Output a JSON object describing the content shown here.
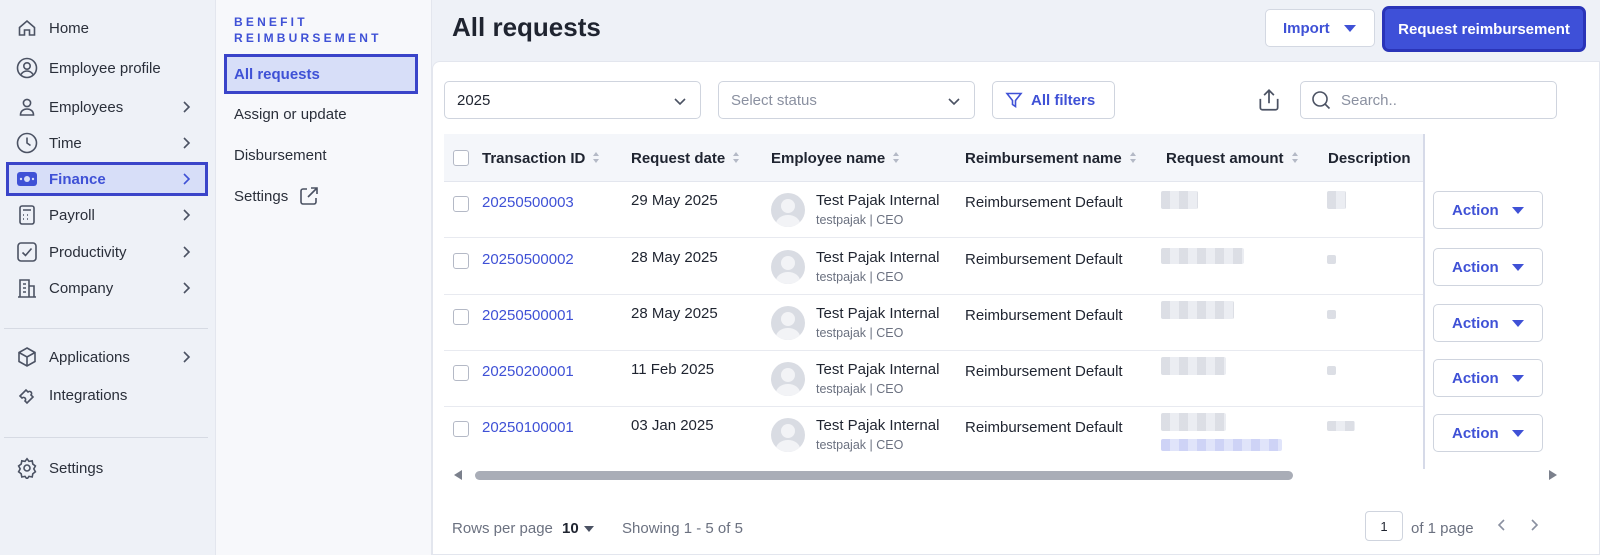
{
  "nav": {
    "items": [
      {
        "label": "Home",
        "icon": "home-icon",
        "chevron": false
      },
      {
        "label": "Employee profile",
        "icon": "user-circle-icon",
        "chevron": false
      },
      {
        "label": "Employees",
        "icon": "user-icon",
        "chevron": true
      },
      {
        "label": "Time",
        "icon": "clock-icon",
        "chevron": true
      },
      {
        "label": "Finance",
        "icon": "finance-icon",
        "chevron": true,
        "active": true
      },
      {
        "label": "Payroll",
        "icon": "calculator-icon",
        "chevron": true
      },
      {
        "label": "Productivity",
        "icon": "checkbox-icon",
        "chevron": true
      },
      {
        "label": "Company",
        "icon": "building-icon",
        "chevron": true
      },
      {
        "label": "Applications",
        "icon": "cube-icon",
        "chevron": true
      },
      {
        "label": "Integrations",
        "icon": "puzzle-icon",
        "chevron": false
      },
      {
        "label": "Settings",
        "icon": "gear-icon",
        "chevron": false
      }
    ]
  },
  "subnav": {
    "title": "BENEFIT REIMBURSEMENT",
    "items": [
      {
        "label": "All requests",
        "active": true
      },
      {
        "label": "Assign or update"
      },
      {
        "label": "Disbursement"
      },
      {
        "label": "Settings",
        "icon": "external-link-icon"
      }
    ]
  },
  "header": {
    "title": "All requests",
    "import_label": "Import",
    "primary_label": "Request reimbursement"
  },
  "filters": {
    "year": "2025",
    "status_placeholder": "Select status",
    "all_filters_label": "All filters",
    "search_placeholder": "Search.."
  },
  "table": {
    "columns": [
      "Transaction ID",
      "Request date",
      "Employee name",
      "Reimbursement name",
      "Request amount",
      "Description"
    ],
    "rows": [
      {
        "id": "20250500003",
        "date": "29 May 2025",
        "employee": "Test Pajak Internal",
        "employee_sub": "testpajak | CEO",
        "reimbursement": "Reimbursement Default",
        "action": "Action"
      },
      {
        "id": "20250500002",
        "date": "28 May 2025",
        "employee": "Test Pajak Internal",
        "employee_sub": "testpajak | CEO",
        "reimbursement": "Reimbursement Default",
        "action": "Action"
      },
      {
        "id": "20250500001",
        "date": "28 May 2025",
        "employee": "Test Pajak Internal",
        "employee_sub": "testpajak | CEO",
        "reimbursement": "Reimbursement Default",
        "action": "Action"
      },
      {
        "id": "20250200001",
        "date": "11 Feb 2025",
        "employee": "Test Pajak Internal",
        "employee_sub": "testpajak | CEO",
        "reimbursement": "Reimbursement Default",
        "action": "Action"
      },
      {
        "id": "20250100001",
        "date": "03 Jan 2025",
        "employee": "Test Pajak Internal",
        "employee_sub": "testpajak | CEO",
        "reimbursement": "Reimbursement Default",
        "action": "Action"
      }
    ]
  },
  "footer": {
    "rows_per_page_label": "Rows per page",
    "rows_per_page_value": "10",
    "showing": "Showing 1 - 5 of 5",
    "page_value": "1",
    "page_of": "of 1 page"
  },
  "colors": {
    "accent": "#3f51d6",
    "active_bg": "#d7def8",
    "highlight_outline": "#3a44c9"
  }
}
